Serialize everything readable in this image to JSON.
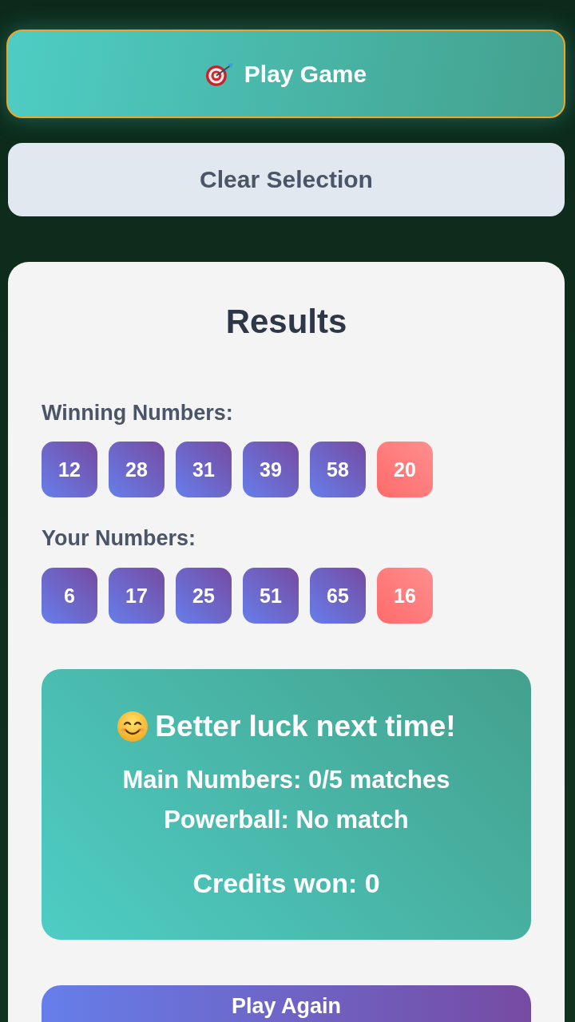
{
  "actions": [
    {
      "kind": "primary",
      "label": "Play Game"
    },
    {
      "kind": "secondary",
      "label": "Clear Selection"
    }
  ],
  "results": {
    "title": "Results",
    "groups": [
      {
        "label": "Winning Numbers:",
        "balls": [
          {
            "number": "12",
            "kind": "main"
          },
          {
            "number": "28",
            "kind": "main"
          },
          {
            "number": "31",
            "kind": "main"
          },
          {
            "number": "39",
            "kind": "main"
          },
          {
            "number": "58",
            "kind": "main"
          },
          {
            "number": "20",
            "kind": "powerball"
          }
        ]
      },
      {
        "label": "Your Numbers:",
        "balls": [
          {
            "number": "6",
            "kind": "main"
          },
          {
            "number": "17",
            "kind": "main"
          },
          {
            "number": "25",
            "kind": "main"
          },
          {
            "number": "51",
            "kind": "main"
          },
          {
            "number": "65",
            "kind": "main"
          },
          {
            "number": "16",
            "kind": "powerball"
          }
        ]
      }
    ],
    "outcome": {
      "headline": "Better luck next time!",
      "lines": [
        "Main Numbers: 0/5 matches",
        "Powerball: No match"
      ],
      "credits": "Credits won: 0"
    },
    "play_again": {
      "label": "Play Again"
    }
  }
}
